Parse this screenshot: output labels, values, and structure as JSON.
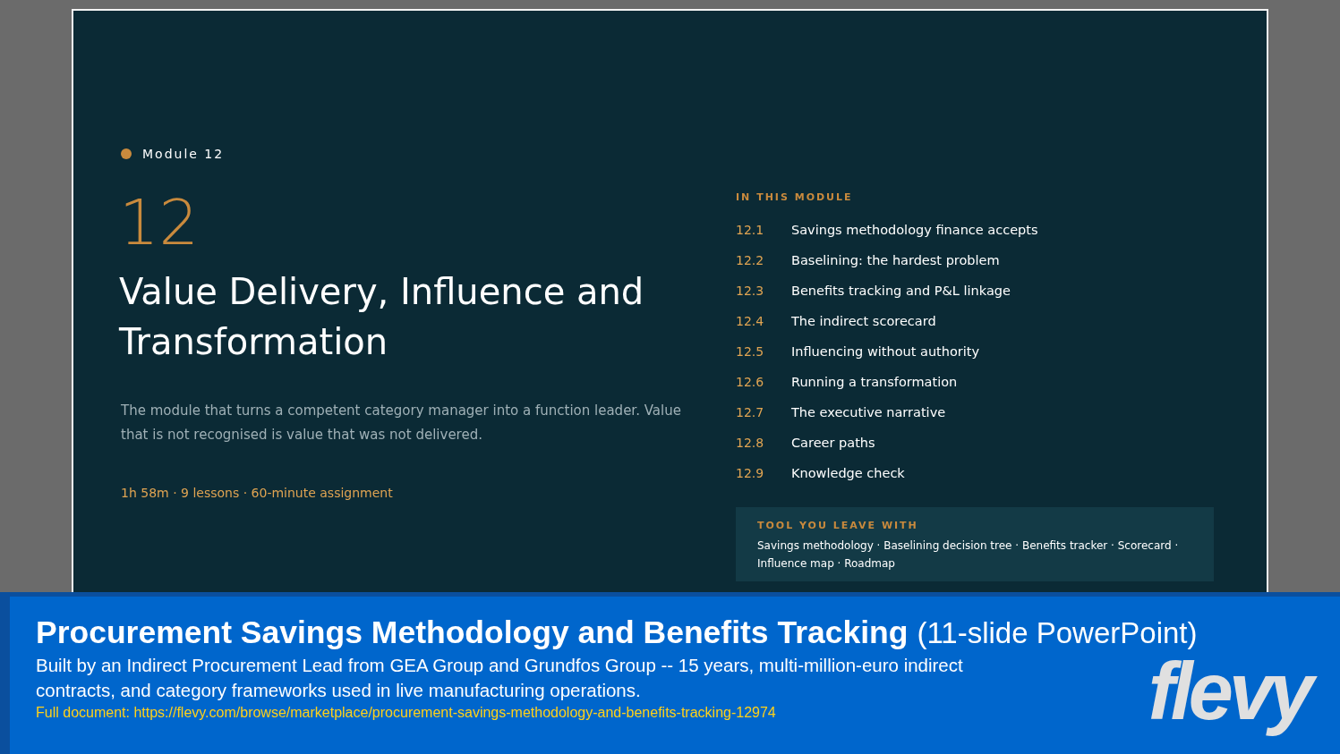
{
  "slide": {
    "module_label": "Module 12",
    "number": "12",
    "title": "Value Delivery, Influence and Transformation",
    "description": "The module that turns a competent category manager into a function leader. Value that is not recognised is value that was not delivered.",
    "meta": "1h 58m · 9 lessons · 60-minute assignment",
    "contents_heading": "IN THIS MODULE",
    "lessons": [
      {
        "number": "12.1",
        "title": "Savings methodology finance accepts"
      },
      {
        "number": "12.2",
        "title": "Baselining: the hardest problem"
      },
      {
        "number": "12.3",
        "title": "Benefits tracking and P&L linkage"
      },
      {
        "number": "12.4",
        "title": "The indirect scorecard"
      },
      {
        "number": "12.5",
        "title": "Influencing without authority"
      },
      {
        "number": "12.6",
        "title": "Running a transformation"
      },
      {
        "number": "12.7",
        "title": "The executive narrative"
      },
      {
        "number": "12.8",
        "title": "Career paths"
      },
      {
        "number": "12.9",
        "title": "Knowledge check"
      }
    ],
    "tools": {
      "heading": "TOOL YOU LEAVE WITH",
      "text": "Savings methodology · Baselining decision tree · Benefits tracker · Scorecard · Influence map · Roadmap"
    }
  },
  "banner": {
    "title": "Procurement Savings Methodology and Benefits Tracking",
    "title_suffix": "(11-slide PowerPoint)",
    "description": "Built by an Indirect Procurement Lead from GEA Group and Grundfos Group -- 15 years, multi-million-euro indirect contracts, and category frameworks used in live manufacturing operations.",
    "link": "Full document: https://flevy.com/browse/marketplace/procurement-savings-methodology-and-benefits-tracking-12974",
    "logo": "flevy"
  }
}
